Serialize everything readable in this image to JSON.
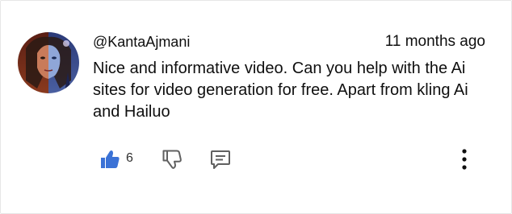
{
  "comment": {
    "author": "@KantaAjmani",
    "timestamp": "11 months ago",
    "text": "Nice and informative video. Can you help with the Ai sites for video generation for free. Apart from kling Ai and Hailuo",
    "like_count": "6"
  },
  "icons": {
    "avatar": "profile-avatar",
    "like": "thumbs-up-icon",
    "dislike": "thumbs-down-icon",
    "reply": "comment-reply-icon",
    "more": "more-vertical-icon"
  },
  "colors": {
    "like_active": "#3b72d6",
    "icon_gray": "#606060",
    "text": "#0f0f0f"
  }
}
